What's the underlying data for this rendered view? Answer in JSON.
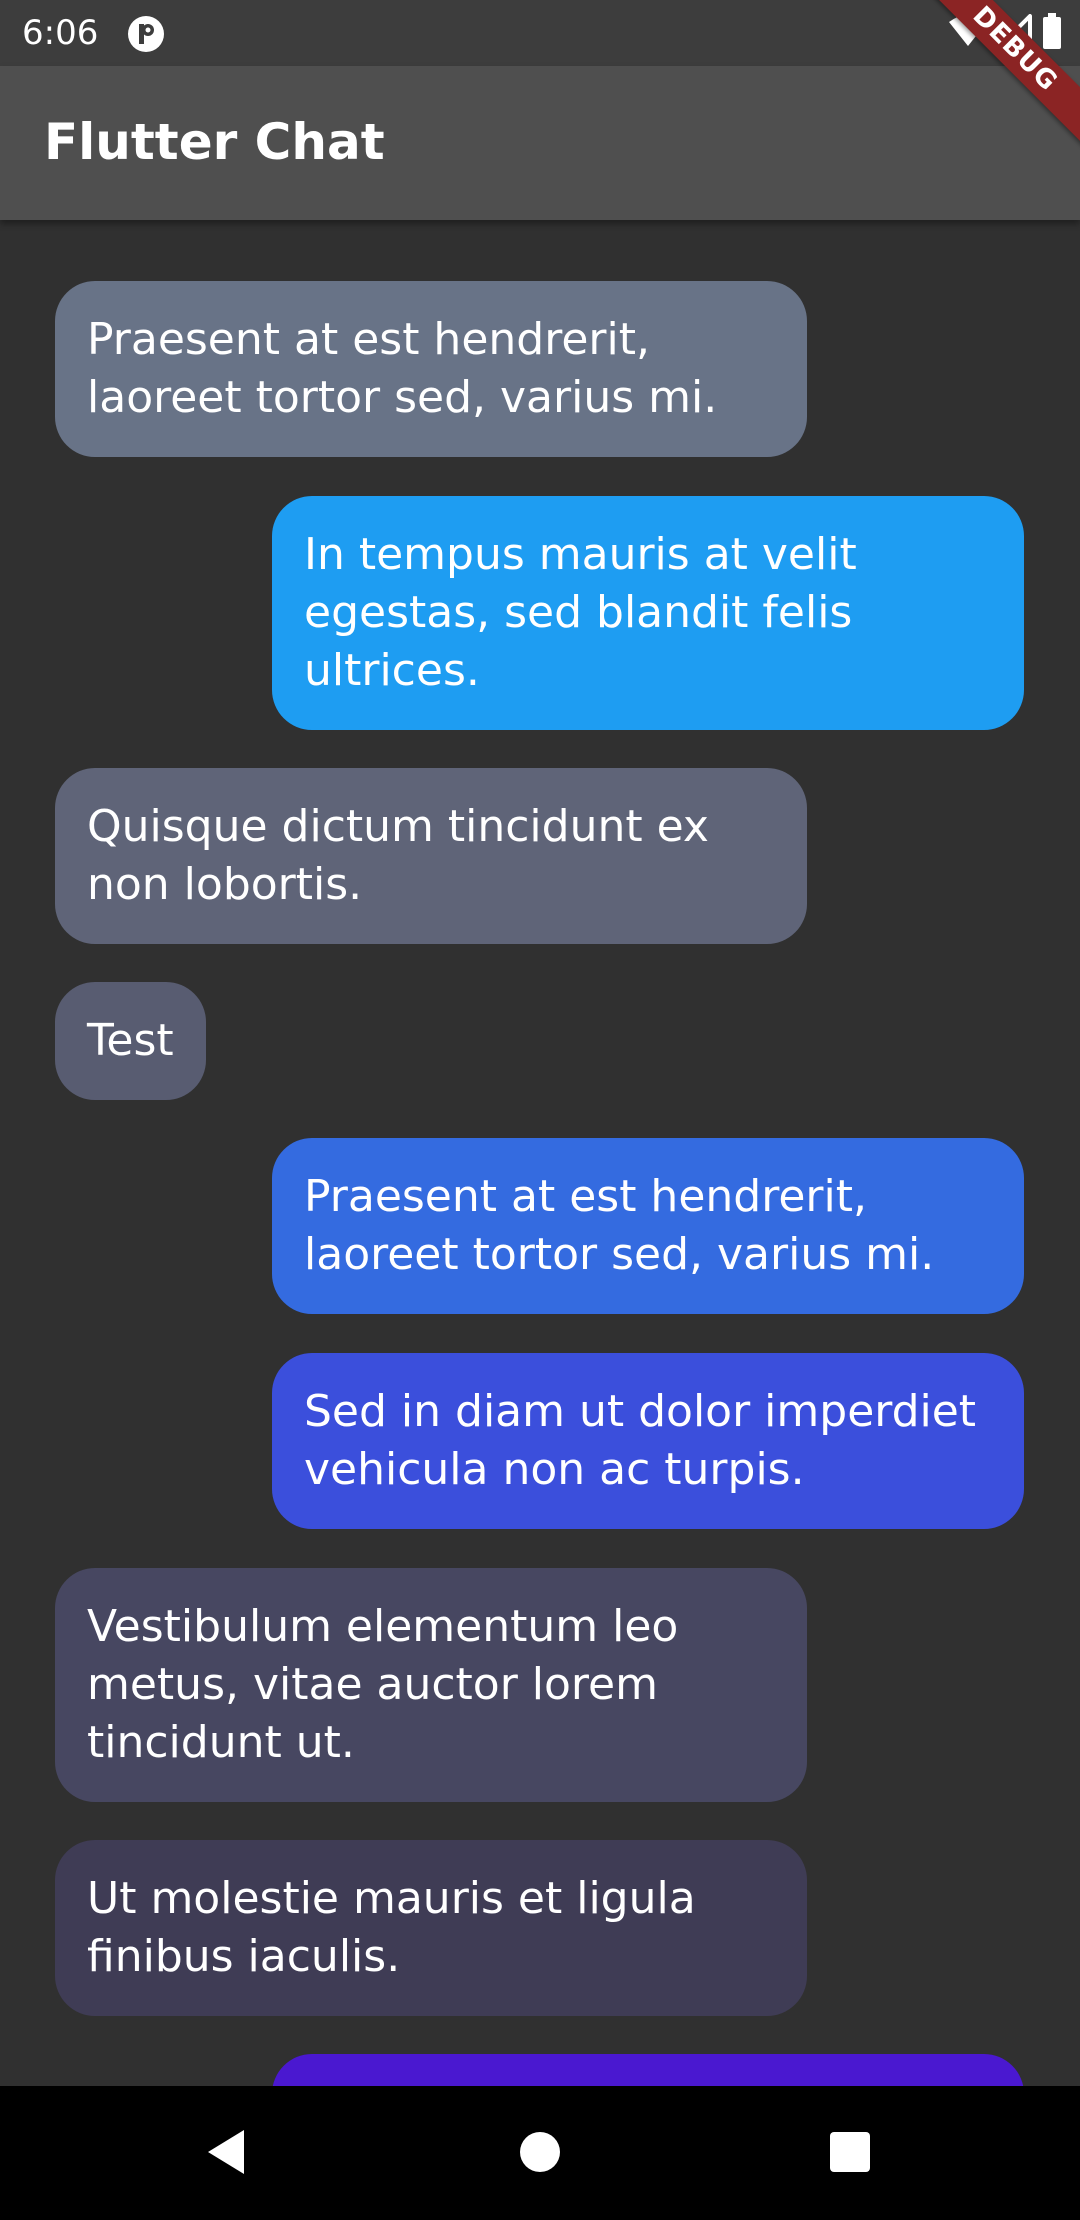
{
  "status_bar": {
    "time": "6:06",
    "icons": [
      "app-notification-icon",
      "wifi-icon",
      "signal-icon",
      "battery-icon"
    ]
  },
  "app_bar": {
    "title": "Flutter Chat"
  },
  "debug_banner": {
    "label": "DEBUG"
  },
  "messages": [
    {
      "side": "received",
      "text": "Praesent at est hendrerit, laoreet tortor sed, varius mi.",
      "color": "#687387"
    },
    {
      "side": "sent",
      "text": "In tempus mauris at velit egestas, sed blandit felis ultrices.",
      "color": "#1e9df2"
    },
    {
      "side": "received",
      "text": "Quisque dictum tincidunt ex non lobortis.",
      "color": "#5f6478"
    },
    {
      "side": "received",
      "text": "Test",
      "color": "#585c71"
    },
    {
      "side": "sent",
      "text": "Praesent at est hendrerit, laoreet tortor sed, varius mi.",
      "color": "#346be0"
    },
    {
      "side": "sent",
      "text": "Sed in diam ut dolor imperdiet vehicula non ac turpis.",
      "color": "#3b4fdc"
    },
    {
      "side": "received",
      "text": "Vestibulum elementum leo metus, vitae auctor lorem tincidunt ut.",
      "color": "#474761"
    },
    {
      "side": "received",
      "text": "Ut molestie mauris et ligula finibus iaculis.",
      "color": "#3f3c55"
    },
    {
      "side": "sent",
      "text": "",
      "color": "#4a18d0"
    }
  ],
  "nav_bar": {
    "buttons": [
      "back-icon",
      "home-icon",
      "recents-icon"
    ]
  }
}
